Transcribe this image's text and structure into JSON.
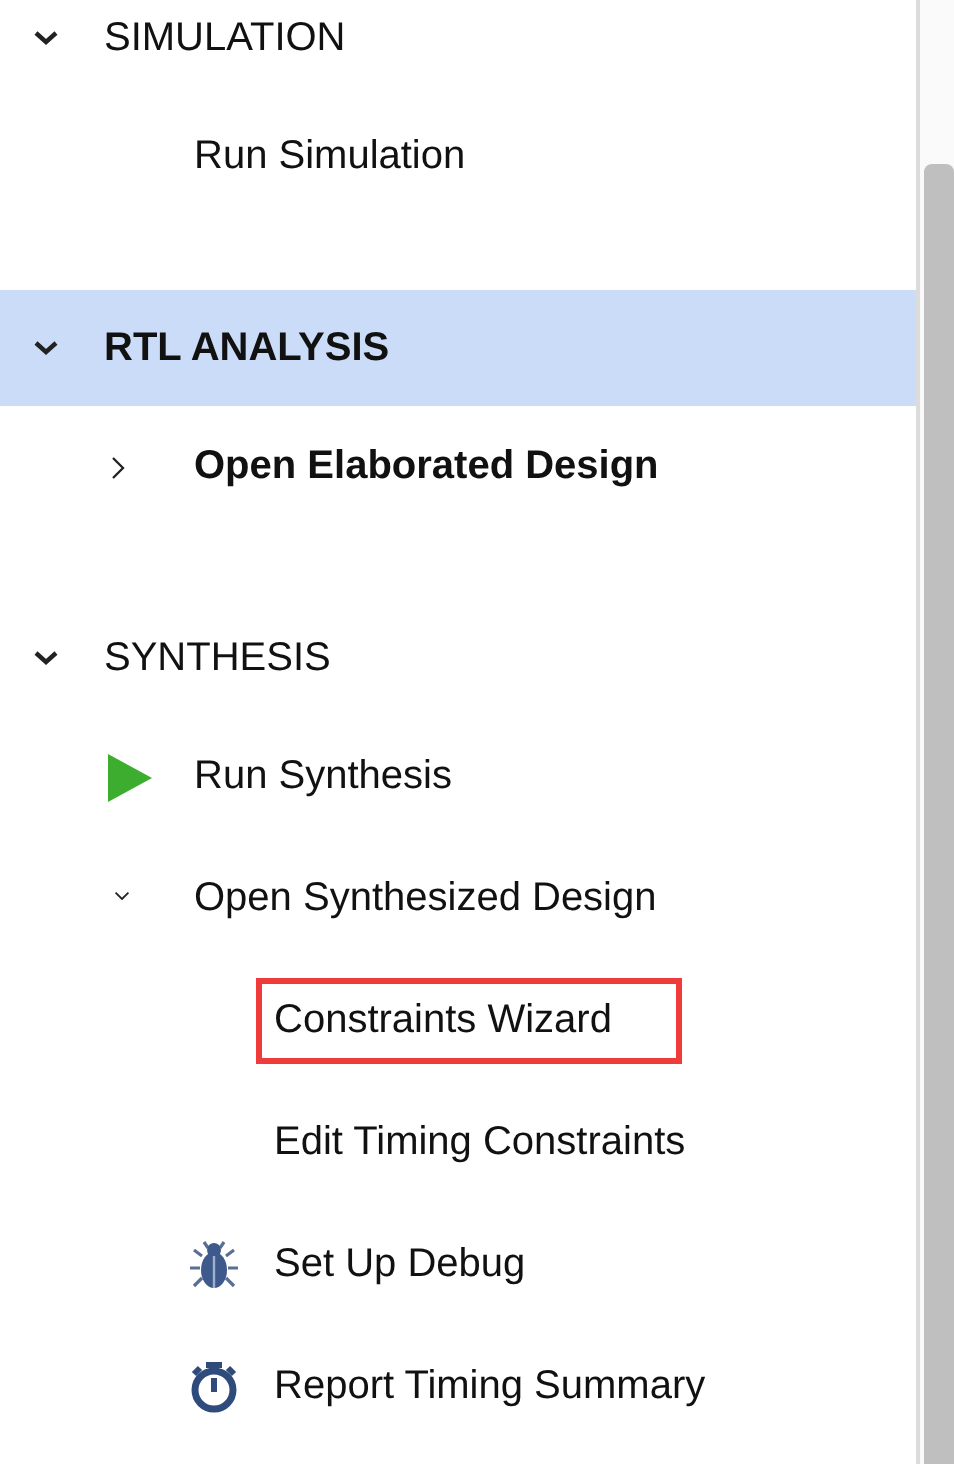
{
  "sections": [
    {
      "title": "SIMULATION",
      "expanded": true,
      "selected": false,
      "items": [
        {
          "label": "Run Simulation",
          "kind": "task",
          "bold": false,
          "annotated": false
        }
      ]
    },
    {
      "title": "RTL ANALYSIS",
      "expanded": true,
      "selected": true,
      "items": [
        {
          "label": "Open Elaborated Design",
          "kind": "task",
          "bold": true,
          "expanded": false,
          "annotated": false
        }
      ]
    },
    {
      "title": "SYNTHESIS",
      "expanded": true,
      "selected": false,
      "items": [
        {
          "label": "Run Synthesis",
          "kind": "run",
          "bold": false,
          "annotated": false
        },
        {
          "label": "Open Synthesized Design",
          "kind": "task",
          "bold": false,
          "expanded": true,
          "annotated": false,
          "children": [
            {
              "label": "Constraints Wizard",
              "kind": "task",
              "bold": false,
              "annotated": true
            },
            {
              "label": "Edit Timing Constraints",
              "kind": "task",
              "bold": false,
              "annotated": false
            },
            {
              "label": "Set Up Debug",
              "kind": "debug",
              "bold": false,
              "annotated": false
            },
            {
              "label": "Report Timing Summary",
              "kind": "report",
              "bold": false,
              "annotated": false
            }
          ]
        }
      ]
    }
  ]
}
